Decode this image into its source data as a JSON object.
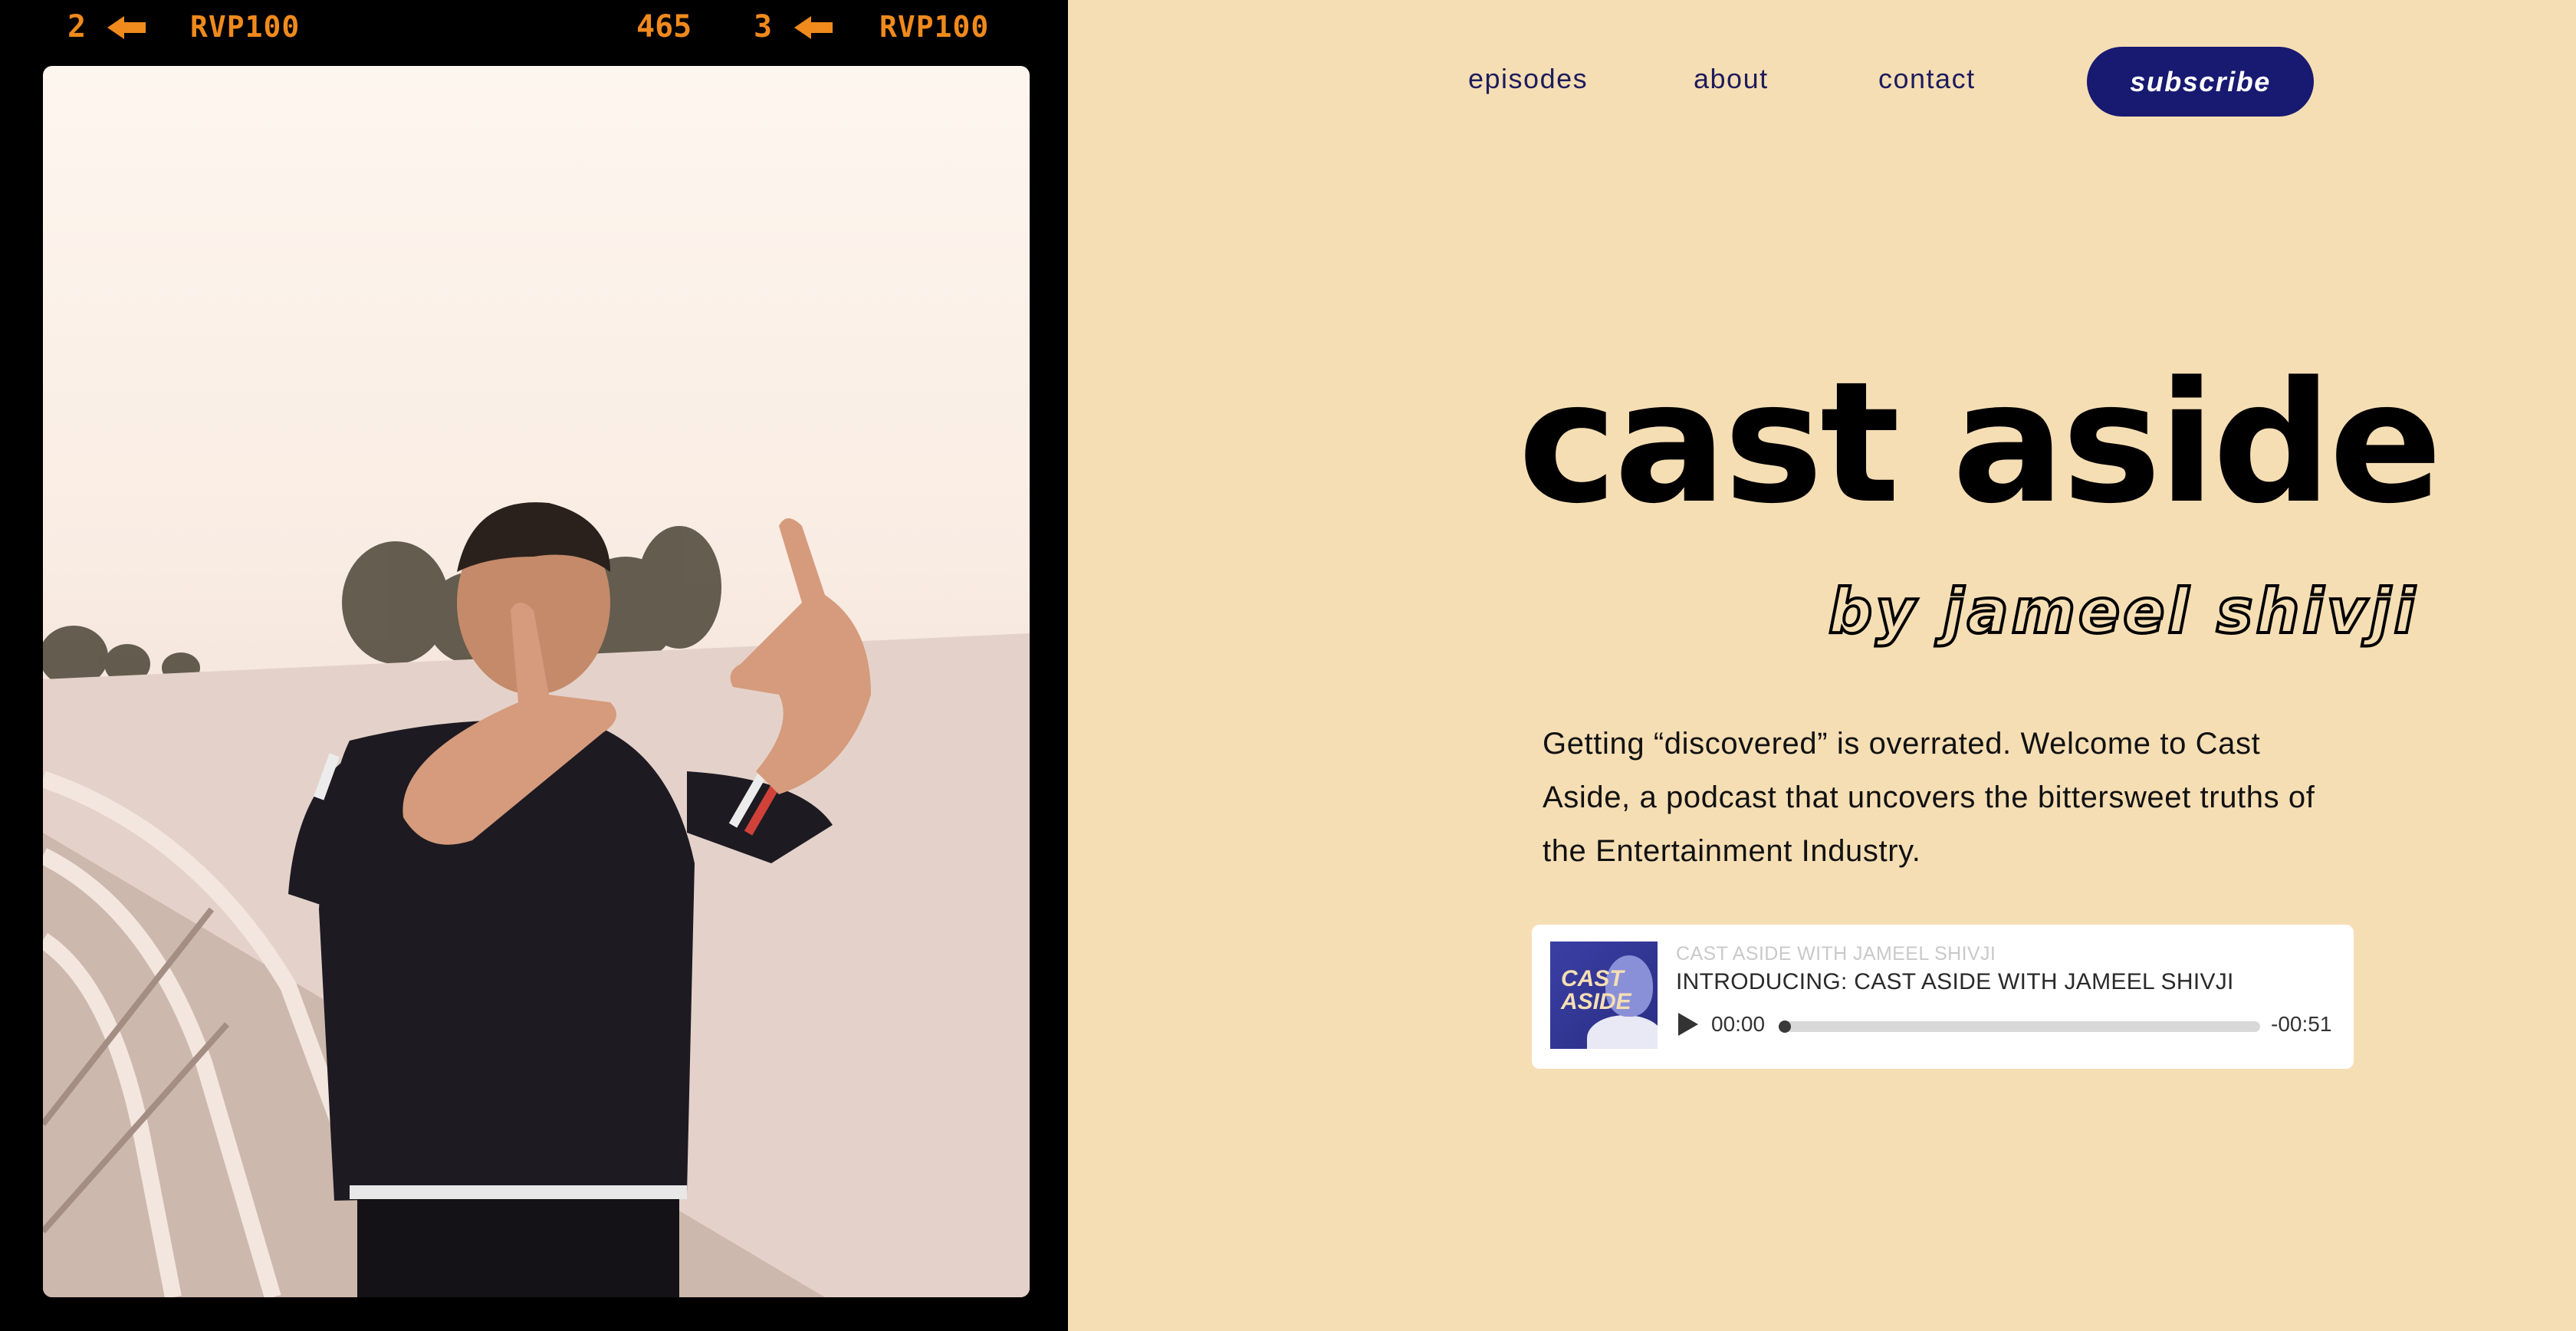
{
  "film": {
    "frame_left_number": "2",
    "frame_left_code": "RVP100",
    "counter": "465",
    "frame_right_number": "3",
    "frame_right_code": "RVP100"
  },
  "nav": {
    "episodes": "episodes",
    "about": "about",
    "contact": "contact",
    "subscribe": "subscribe"
  },
  "hero": {
    "title": "cast aside",
    "byline": "by jameel shivji",
    "description": "Getting “discovered” is overrated. Welcome to Cast Aside, a podcast that uncovers the bittersweet truths of the Entertainment Industry."
  },
  "player": {
    "cover_text_line1": "CAST",
    "cover_text_line2": "ASIDE",
    "show_name": "CAST ASIDE WITH JAMEEL SHIVJI",
    "episode_title": "INTRODUCING: CAST ASIDE WITH JAMEEL SHIVJI",
    "current_time": "00:00",
    "remaining_time": "-00:51",
    "progress": 0
  },
  "colors": {
    "background": "#f6deb4",
    "nav_text": "#1d1c5c",
    "subscribe_bg": "#181971",
    "film_text": "#f08a1c"
  }
}
